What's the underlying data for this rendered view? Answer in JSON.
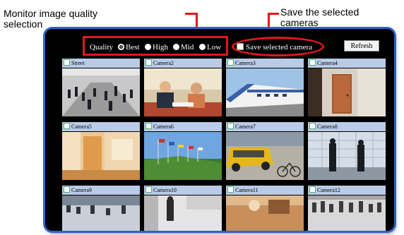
{
  "annotations": {
    "quality_callout": "Monitor image quality\nselection",
    "quality_callout_line1": "Monitor image quality",
    "quality_callout_line2": "selection",
    "save_callout_line1": "Save the selected",
    "save_callout_line2": "cameras"
  },
  "toolbar": {
    "quality_label": "Quality",
    "quality_options": [
      "Best",
      "High",
      "Mid",
      "Low"
    ],
    "quality_selected": "Best",
    "save_label": "Save selected camera",
    "save_checked": false,
    "refresh_label": "Refresh"
  },
  "cameras": [
    {
      "label": "Street",
      "checked": true
    },
    {
      "label": "Camera2",
      "checked": true
    },
    {
      "label": "Camera3",
      "checked": true
    },
    {
      "label": "Camera4",
      "checked": true
    },
    {
      "label": "Camera5",
      "checked": true
    },
    {
      "label": "Camera6",
      "checked": true
    },
    {
      "label": "Camera7",
      "checked": true
    },
    {
      "label": "Camera8",
      "checked": true
    },
    {
      "label": "Camera9",
      "checked": true
    },
    {
      "label": "Camera10",
      "checked": true
    },
    {
      "label": "Camera11",
      "checked": true
    },
    {
      "label": "Camera12",
      "checked": true
    }
  ],
  "colors": {
    "annotation_red": "#e0191c",
    "frame_border_blue": "#2f64c6",
    "camera_header_blue": "#b9cbe6"
  }
}
